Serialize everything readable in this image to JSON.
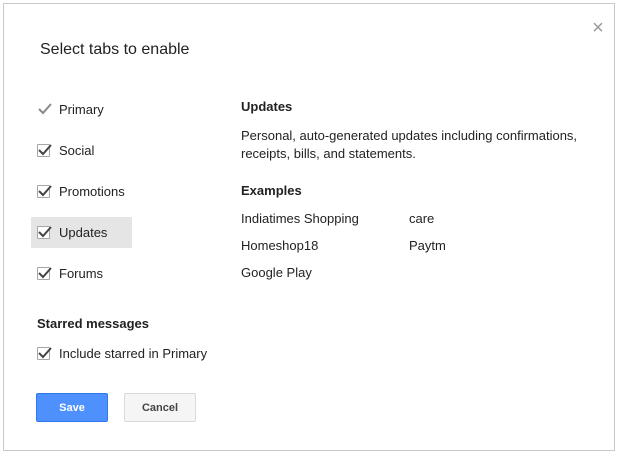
{
  "dialog": {
    "title": "Select tabs to enable",
    "close_label": "×"
  },
  "tabs": [
    {
      "label": "Primary",
      "checked": true,
      "locked": true
    },
    {
      "label": "Social",
      "checked": true
    },
    {
      "label": "Promotions",
      "checked": true
    },
    {
      "label": "Updates",
      "checked": true,
      "selected": true
    },
    {
      "label": "Forums",
      "checked": true
    }
  ],
  "starred": {
    "heading": "Starred messages",
    "option_label": "Include starred in Primary",
    "checked": true
  },
  "details": {
    "heading": "Updates",
    "description": "Personal, auto-generated updates including confirmations, receipts, bills, and statements.",
    "examples_heading": "Examples",
    "examples": [
      "Indiatimes Shopping",
      "care",
      "Homeshop18",
      "Paytm",
      "Google Play"
    ]
  },
  "buttons": {
    "save": "Save",
    "cancel": "Cancel"
  },
  "colors": {
    "primary_button": "#4d90fe",
    "selected_row": "#e5e5e5"
  }
}
